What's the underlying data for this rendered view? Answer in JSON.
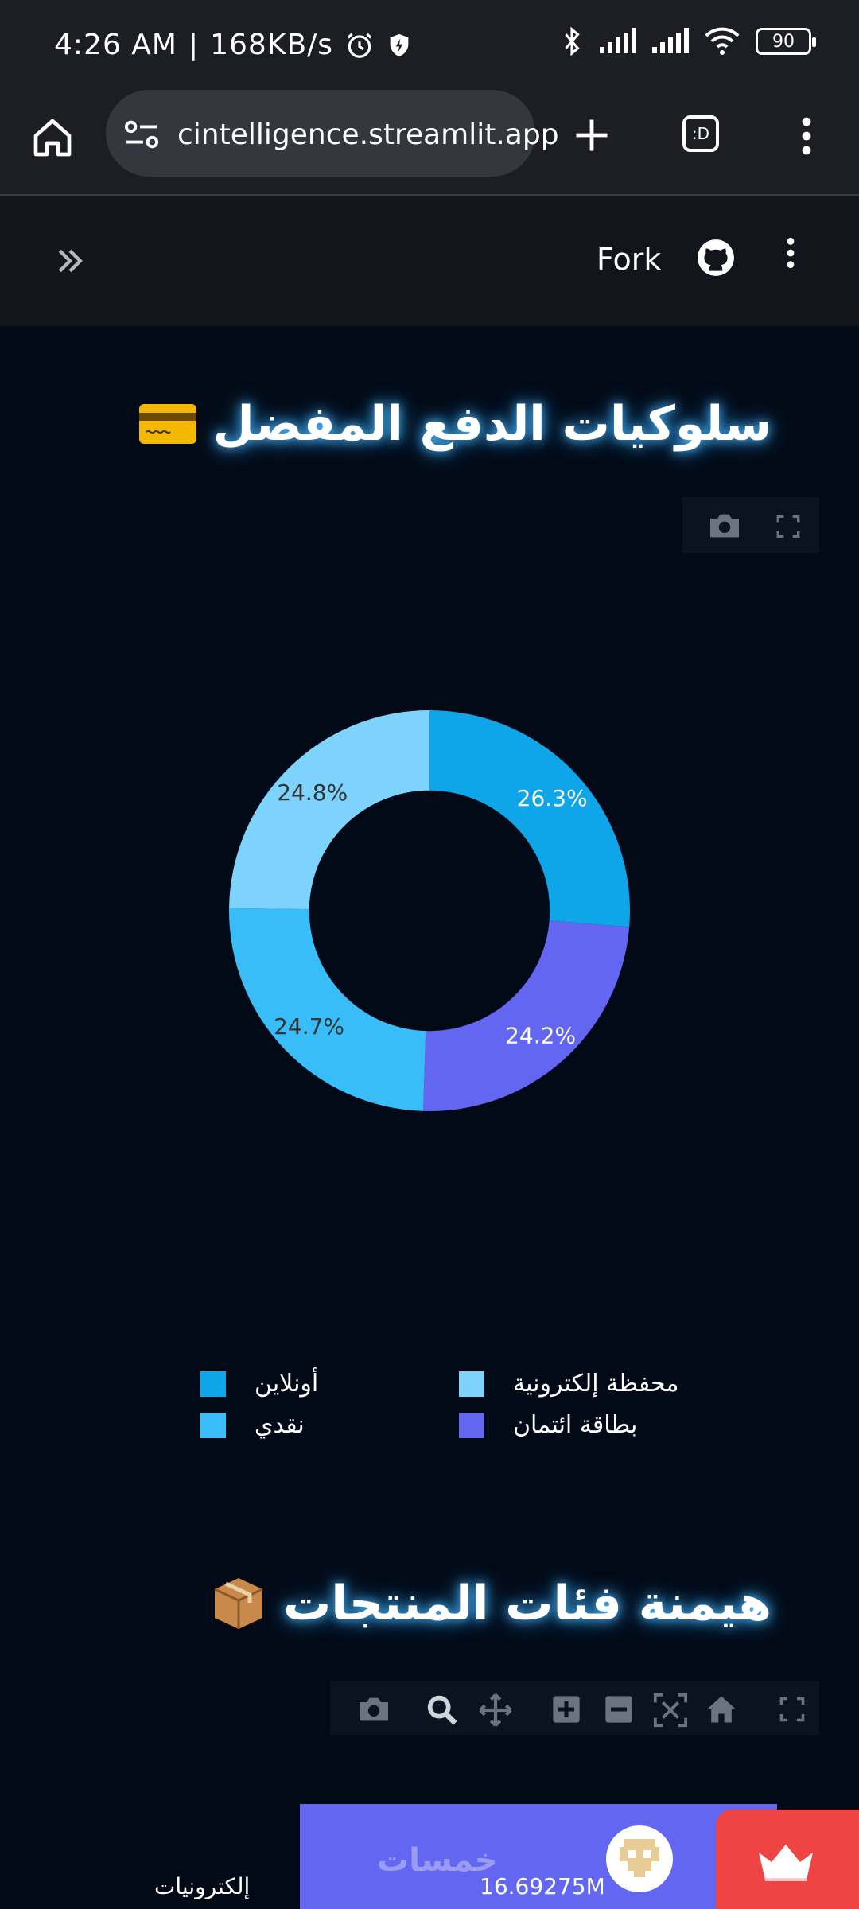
{
  "status_bar": {
    "time": "4:26 AM",
    "speed": "168KB/s",
    "battery": "90"
  },
  "browser": {
    "url": "cintelligence.streamlit.app"
  },
  "app_header": {
    "fork_label": "Fork"
  },
  "section1": {
    "title": "سلوكيات الدفع المفضل",
    "emoji": "💳"
  },
  "section2": {
    "title": "هيمنة فئات المنتجات",
    "emoji": "📦"
  },
  "chart_data": [
    {
      "type": "pie",
      "hole": 0.6,
      "slices": [
        {
          "label": "أونلاين",
          "value": 26.3,
          "text": "26.3%",
          "color": "#0ea5e9"
        },
        {
          "label": "بطاقة ائتمان",
          "value": 24.2,
          "text": "24.2%",
          "color": "#6366f1"
        },
        {
          "label": "نقدي",
          "value": 24.7,
          "text": "24.7%",
          "color": "#38bdf8"
        },
        {
          "label": "محفظة إلكترونية",
          "value": 24.8,
          "text": "24.8%",
          "color": "#7dd3fc"
        }
      ],
      "legend": [
        {
          "label": "أونلاين",
          "color": "#0ea5e9"
        },
        {
          "label": "محفظة إلكترونية",
          "color": "#7dd3fc"
        },
        {
          "label": "نقدي",
          "color": "#38bdf8"
        },
        {
          "label": "بطاقة ائتمان",
          "color": "#6366f1"
        }
      ],
      "legend_placement": "bottom"
    },
    {
      "type": "bar",
      "orientation": "horizontal",
      "categories": [
        "إلكترونيات"
      ],
      "values": [
        16.69275
      ],
      "value_text": "16.69275M",
      "color": "#6366f1"
    }
  ],
  "watermark": "خمسات"
}
